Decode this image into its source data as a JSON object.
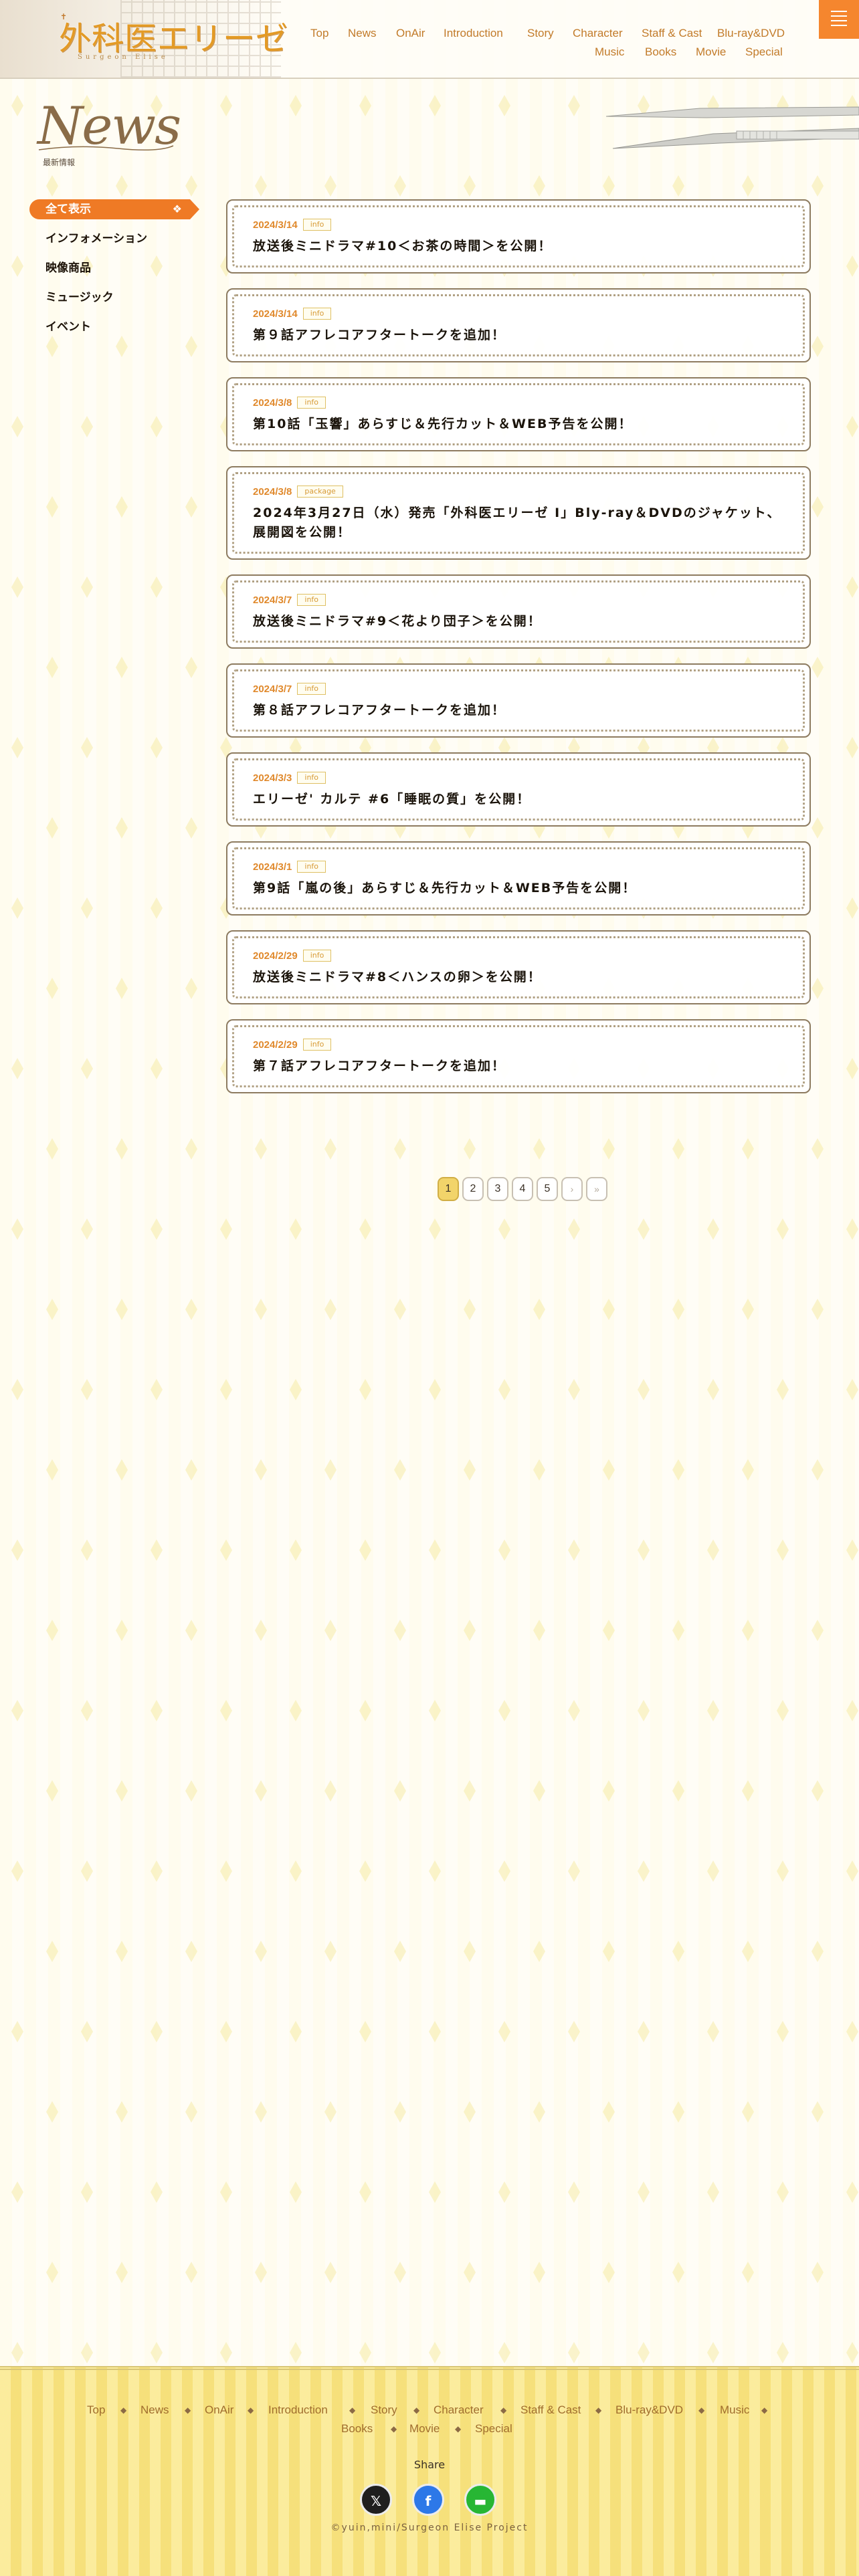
{
  "header": {
    "logo_text": "外科医エリーゼ",
    "logo_sub": "Surgeon Elise",
    "nav_row1": [
      "Top",
      "News",
      "OnAir",
      "Introduction",
      "Story",
      "Character",
      "Staff & Cast",
      "Blu-ray&DVD"
    ],
    "nav_row2": [
      "Music",
      "Books",
      "Movie",
      "Special"
    ]
  },
  "page": {
    "title_en": "News",
    "title_ja": "最新情報"
  },
  "sidebar": {
    "categories": [
      "全て表示",
      "インフォメーション",
      "映像商品",
      "ミュージック",
      "イベント"
    ]
  },
  "news": [
    {
      "date": "2024/3/14",
      "tag": "info",
      "title": "放送後ミニドラマ#10＜お茶の時間＞を公開！"
    },
    {
      "date": "2024/3/14",
      "tag": "info",
      "title": "第９話アフレコアフタートークを追加！"
    },
    {
      "date": "2024/3/8",
      "tag": "info",
      "title": "第10話「玉響」あらすじ＆先行カット＆WEB予告を公開！"
    },
    {
      "date": "2024/3/8",
      "tag": "package",
      "title": "2024年3月27日（水）発売「外科医エリーゼ Ⅰ」Bly-ray＆DVDのジャケット、展開図を公開！"
    },
    {
      "date": "2024/3/7",
      "tag": "info",
      "title": "放送後ミニドラマ#9＜花より団子＞を公開！"
    },
    {
      "date": "2024/3/7",
      "tag": "info",
      "title": "第８話アフレコアフタートークを追加！"
    },
    {
      "date": "2024/3/3",
      "tag": "info",
      "title": "エリーゼ' カルテ #6「睡眠の質」を公開！"
    },
    {
      "date": "2024/3/1",
      "tag": "info",
      "title": "第9話「嵐の後」あらすじ＆先行カット＆WEB予告を公開！"
    },
    {
      "date": "2024/2/29",
      "tag": "info",
      "title": "放送後ミニドラマ#8＜ハンスの卵＞を公開！"
    },
    {
      "date": "2024/2/29",
      "tag": "info",
      "title": "第７話アフレコアフタートークを追加！"
    }
  ],
  "pagination": {
    "pages": [
      "1",
      "2",
      "3",
      "4",
      "5"
    ],
    "current": "1",
    "next_label": "›",
    "last_label": "»"
  },
  "footer": {
    "nav_row1": [
      "Top",
      "News",
      "OnAir",
      "Introduction",
      "Story",
      "Character",
      "Staff & Cast",
      "Blu-ray&DVD",
      "Music"
    ],
    "nav_row2": [
      "Books",
      "Movie",
      "Special"
    ],
    "share_label": "Share",
    "copyright": "©yuin,mini/Surgeon Elise Project"
  },
  "colors": {
    "accent": "#ef7a25",
    "date": "#e0892c",
    "nav": "#c27b2a",
    "footer_bg": "#f8e68a",
    "x_brand": "#1f1f1f",
    "facebook": "#2d78e8",
    "line": "#27b634"
  },
  "icons": {
    "menu": "hamburger-icon",
    "category_active": "diamond-icon",
    "share": [
      "x-icon",
      "facebook-icon",
      "line-icon"
    ]
  }
}
